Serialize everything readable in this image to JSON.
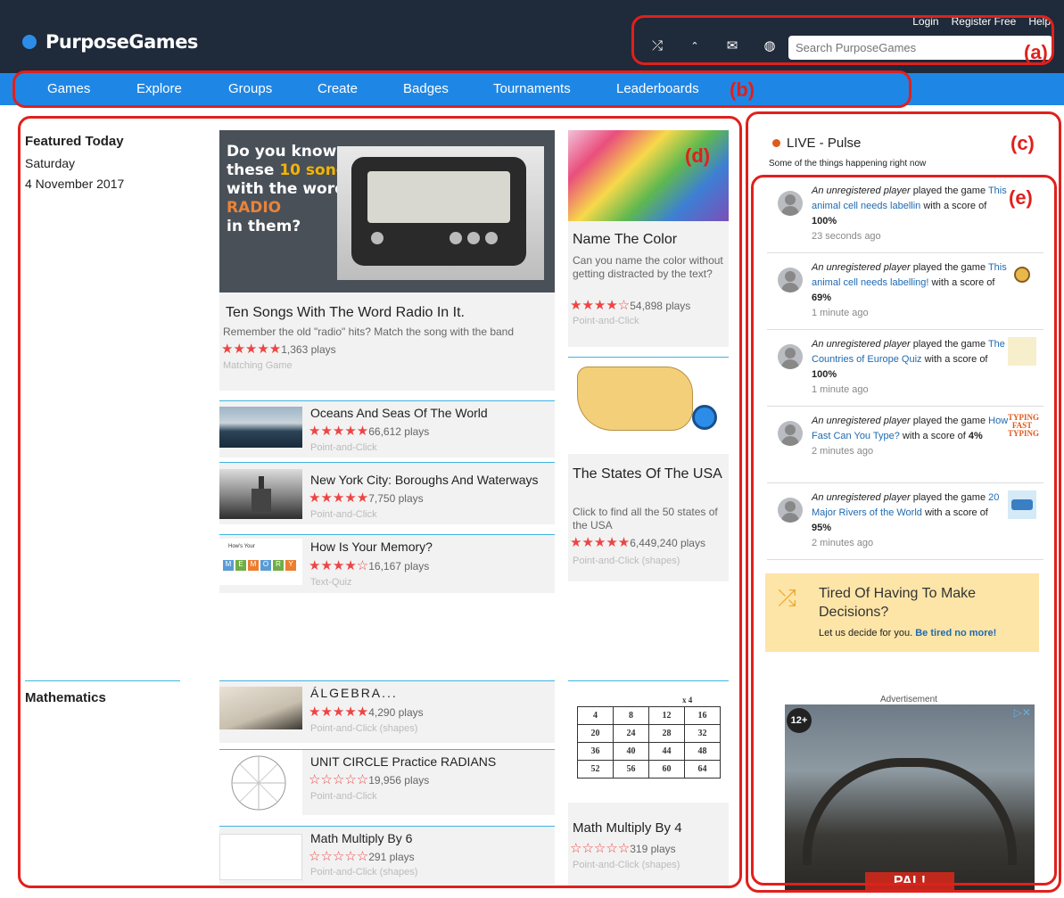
{
  "header": {
    "logo_text": "PurposeGames",
    "links": [
      "Login",
      "Register Free",
      "Help"
    ],
    "icons": [
      "shuffle-icon",
      "chevron-up-icon",
      "mail-icon",
      "globe-icon"
    ],
    "search_placeholder": "Search PurposeGames"
  },
  "nav": {
    "items": [
      "Games",
      "Explore",
      "Groups",
      "Create",
      "Badges",
      "Tournaments",
      "Leaderboards"
    ]
  },
  "annotations": {
    "a": "(a)",
    "b": "(b)",
    "c": "(c)",
    "d": "(d)",
    "e": "(e)"
  },
  "featured": {
    "title": "Featured Today",
    "day": "Saturday",
    "date": "4 November 2017",
    "main": {
      "poster_lines": [
        "Do you know",
        "these ",
        "10 songs",
        "with the word",
        "RADIO",
        "in them?"
      ],
      "title": "Ten Songs With The Word Radio In It.",
      "desc": "Remember the old \"radio\" hits? Match the song with the band",
      "stars": "★★★★★",
      "plays": "1,363 plays",
      "type": "Matching Game"
    },
    "list": [
      {
        "title": "Oceans And Seas Of The World",
        "stars": "★★★★★",
        "plays": "66,612 plays",
        "type": "Point-and-Click"
      },
      {
        "title": "New York City: Boroughs And Waterways",
        "stars": "★★★★★",
        "plays": "7,750 plays",
        "type": "Point-and-Click"
      },
      {
        "title": "How Is Your Memory?",
        "stars": "★★★★☆",
        "plays": "16,167 plays",
        "type": "Text-Quiz",
        "thumb_caption": "How's Your",
        "thumb_letters": [
          "M",
          "E",
          "M",
          "O",
          "R",
          "Y"
        ]
      }
    ],
    "side": [
      {
        "title": "Name The Color",
        "desc": "Can you name the color without getting distracted by the text?",
        "stars": "★★★★☆",
        "plays": "54,898 plays",
        "type": "Point-and-Click"
      },
      {
        "title": "The States Of The USA",
        "desc": "Click to find all the 50 states of the USA",
        "stars": "★★★★★",
        "plays": "6,449,240 plays",
        "type": "Point-and-Click (shapes)"
      }
    ]
  },
  "mathematics": {
    "title": "Mathematics",
    "list": [
      {
        "title": "ÁLGEBRA...",
        "stars": "★★★★★",
        "plays": "4,290 plays",
        "type": "Point-and-Click (shapes)"
      },
      {
        "title": "UNIT CIRCLE Practice RADIANS",
        "stars": "☆☆☆☆☆",
        "plays": "19,956 plays",
        "type": "Point-and-Click"
      },
      {
        "title": "Math Multiply By 6",
        "stars": "☆☆☆☆☆",
        "plays": "291 plays",
        "type": "Point-and-Click (shapes)"
      }
    ],
    "side": {
      "title": "Math Multiply By 4",
      "stars": "☆☆☆☆☆",
      "plays": "319 plays",
      "type": "Point-and-Click (shapes)",
      "grid_header": "x 4",
      "grid": [
        [
          "4",
          "8",
          "12",
          "16"
        ],
        [
          "20",
          "24",
          "28",
          "32"
        ],
        [
          "36",
          "40",
          "44",
          "48"
        ],
        [
          "52",
          "56",
          "60",
          "64"
        ]
      ]
    }
  },
  "pulse": {
    "title": "LIVE - Pulse",
    "subtitle": "Some of the things happening right now",
    "items": [
      {
        "who": "An unregistered player",
        "verb": " played the game ",
        "game": "This animal cell needs labellin",
        "score_pre": " with a score of ",
        "score": "100%",
        "time": "23 seconds ago"
      },
      {
        "who": "An unregistered player",
        "verb": " played the game ",
        "game": "This animal cell needs labelling!",
        "score_pre": " with a score of ",
        "score": "69%",
        "time": "1 minute ago"
      },
      {
        "who": "An unregistered player",
        "verb": " played the game ",
        "game": "The Countries of Europe Quiz",
        "score_pre": " with a score of ",
        "score": "100%",
        "time": "1 minute ago"
      },
      {
        "who": "An unregistered player",
        "verb": " played the game ",
        "game": "How Fast Can You Type?",
        "score_pre": " with a score of ",
        "score": "4%",
        "time": "2 minutes ago"
      },
      {
        "who": "An unregistered player",
        "verb": " played the game ",
        "game": "20 Major Rivers of the World",
        "score_pre": " with a score of ",
        "score": "95%",
        "time": "2 minutes ago"
      }
    ],
    "typing_thumb": [
      "TYPING",
      "FAST",
      "TYPING"
    ]
  },
  "tired": {
    "title": "Tired Of Having To Make Decisions?",
    "text": "Let us decide for you. ",
    "link": "Be tired no more!"
  },
  "ad": {
    "label": "Advertisement",
    "rating": "12+",
    "banner": "PAL!"
  },
  "colors": {
    "header_bg": "#1f2a3a",
    "nav_bg": "#1e87e6",
    "annotation": "#e0201c",
    "star": "#e44444",
    "link": "#1e6ab0"
  }
}
